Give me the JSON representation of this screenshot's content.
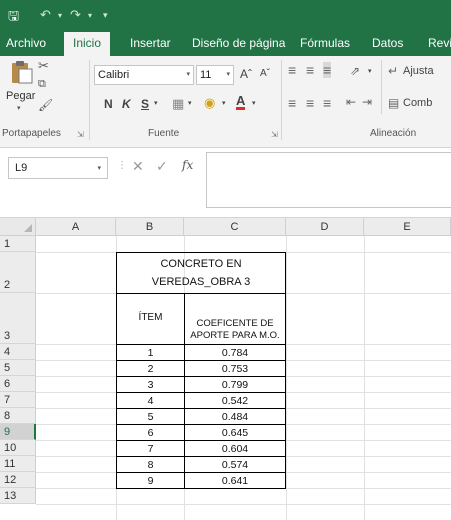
{
  "app": {
    "quick_access": {
      "save_icon": "save-icon",
      "undo_icon": "undo-icon",
      "redo_icon": "redo-icon"
    },
    "accent_color": "#217346"
  },
  "ribbon": {
    "tabs": [
      {
        "label": "Archivo",
        "active": false
      },
      {
        "label": "Inicio",
        "active": true
      },
      {
        "label": "Insertar",
        "active": false
      },
      {
        "label": "Diseño de página",
        "active": false
      },
      {
        "label": "Fórmulas",
        "active": false
      },
      {
        "label": "Datos",
        "active": false
      },
      {
        "label": "Revis",
        "active": false
      }
    ],
    "clipboard": {
      "paste_label": "Pegar",
      "group_label": "Portapapeles"
    },
    "font": {
      "font_name": "Calibri",
      "font_size": "11",
      "bold": "N",
      "italic": "K",
      "underline": "S",
      "group_label": "Fuente"
    },
    "alignment": {
      "wrap_label": "Ajusta",
      "merge_label": "Comb",
      "group_label": "Alineación"
    }
  },
  "formula_bar": {
    "name_box": "L9",
    "fx_label": "fx",
    "value": ""
  },
  "grid": {
    "columns": [
      "A",
      "B",
      "C",
      "D",
      "E"
    ],
    "rows": [
      "1",
      "2",
      "3",
      "4",
      "5",
      "6",
      "7",
      "8",
      "9",
      "10",
      "11",
      "12",
      "13"
    ],
    "selected_row": "9",
    "table": {
      "title_line1": "CONCRETO EN",
      "title_line2": "VEREDAS_OBRA 3",
      "header_item": "ÍTEM",
      "header_coef_line1": "COEFICENTE DE",
      "header_coef_line2": "APORTE PARA M.O.",
      "rows": [
        {
          "item": "1",
          "value": "0.784"
        },
        {
          "item": "2",
          "value": "0.753"
        },
        {
          "item": "3",
          "value": "0.799"
        },
        {
          "item": "4",
          "value": "0.542"
        },
        {
          "item": "5",
          "value": "0.484"
        },
        {
          "item": "6",
          "value": "0.645"
        },
        {
          "item": "7",
          "value": "0.604"
        },
        {
          "item": "8",
          "value": "0.574"
        },
        {
          "item": "9",
          "value": "0.641"
        }
      ]
    }
  }
}
